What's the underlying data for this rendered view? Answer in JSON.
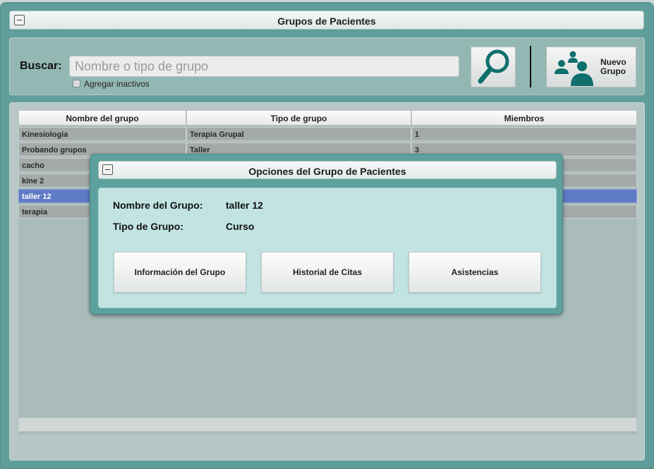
{
  "main_window": {
    "title": "Grupos de Pacientes"
  },
  "search": {
    "label": "Buscar:",
    "placeholder": "Nombre o tipo de grupo",
    "value": "",
    "include_inactive_label": "Agregar inactivos",
    "include_inactive_checked": false,
    "new_group_label_line1": "Nuevo",
    "new_group_label_line2": "Grupo"
  },
  "table": {
    "headers": [
      "Nombre del grupo",
      "Tipo de grupo",
      "Miembros"
    ],
    "rows": [
      {
        "name": "Kinesiologia",
        "type": "Terapia Grupal",
        "members": "1",
        "selected": false
      },
      {
        "name": "Probando grupos",
        "type": "Taller",
        "members": "3",
        "selected": false
      },
      {
        "name": "cacho",
        "type": "",
        "members": "",
        "selected": false
      },
      {
        "name": "kine 2",
        "type": "",
        "members": "",
        "selected": false
      },
      {
        "name": "taller 12",
        "type": "",
        "members": "",
        "selected": true
      },
      {
        "name": "terapia",
        "type": "",
        "members": "",
        "selected": false
      }
    ]
  },
  "dialog": {
    "title": "Opciones del Grupo de Pacientes",
    "group_name_label": "Nombre del Grupo:",
    "group_name_value": "taller 12",
    "group_type_label": "Tipo de Grupo:",
    "group_type_value": "Curso",
    "buttons": {
      "info": "Información del Grupo",
      "history": "Historial de Citas",
      "attendance": "Asistencias"
    }
  },
  "colors": {
    "accent": "#5f9e9a",
    "selected_row": "#5f7bc6",
    "icon": "#0f6f6c"
  }
}
